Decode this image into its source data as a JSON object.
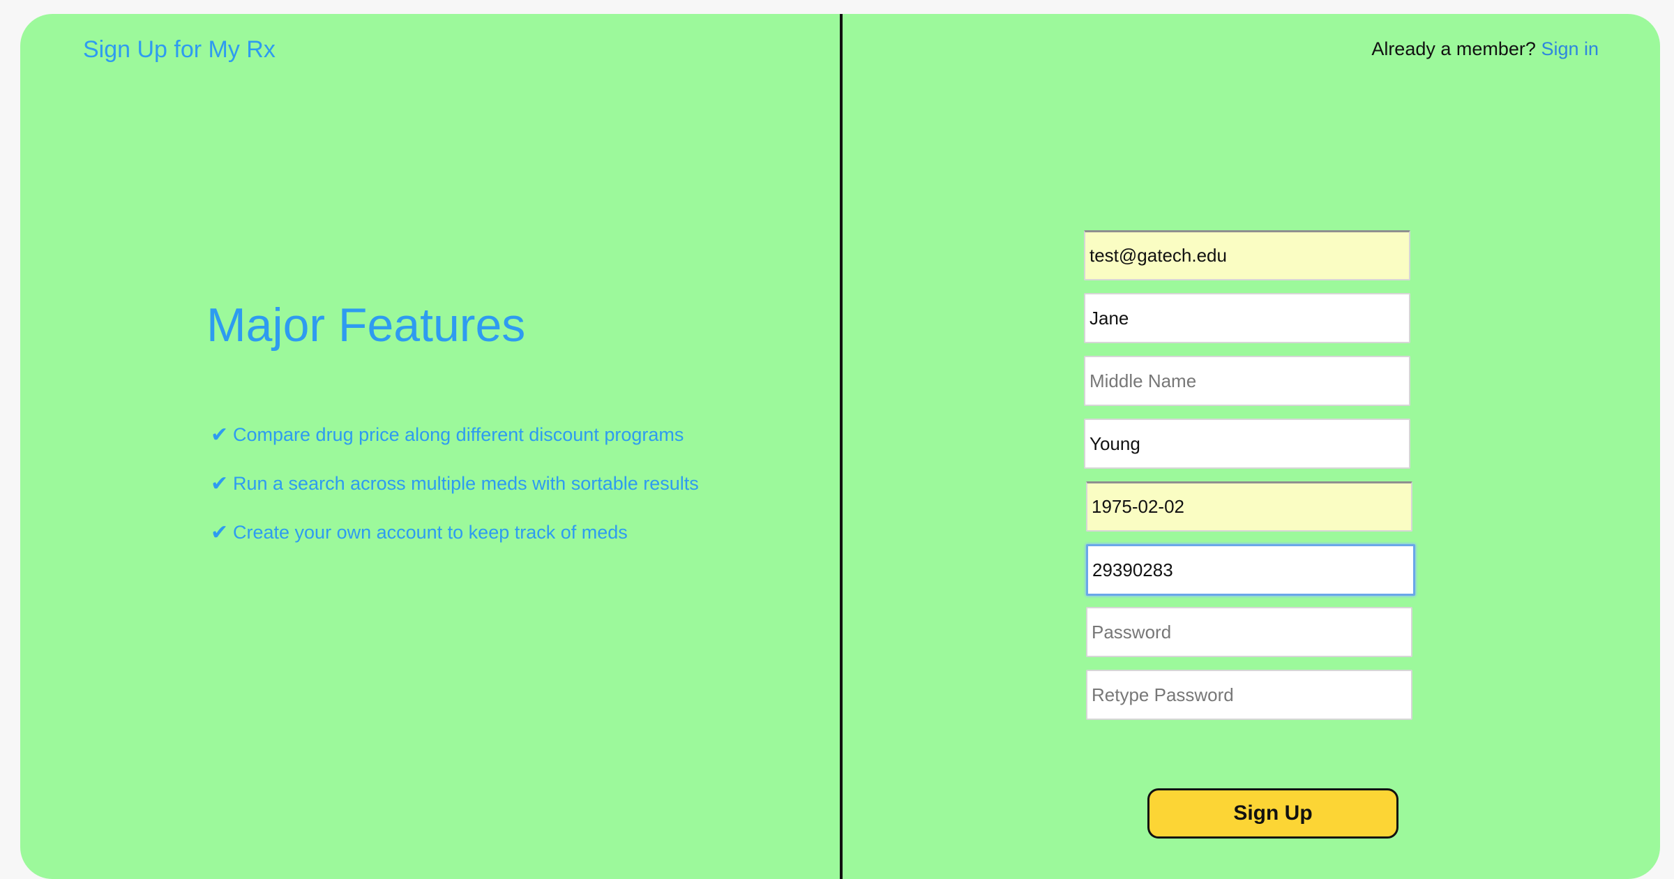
{
  "brand": {
    "title": "Sign Up for My Rx"
  },
  "features": {
    "heading": "Major Features",
    "check_icon": "✔",
    "items": [
      "Compare drug price along different discount programs",
      "Run a search across multiple meds with sortable results",
      "Create your own account to keep track of meds"
    ]
  },
  "header": {
    "member_prompt": "Already a member?",
    "signin_label": "Sign in"
  },
  "form": {
    "email": {
      "value": "test@gatech.edu",
      "placeholder": ""
    },
    "first_name": {
      "value": "Jane",
      "placeholder": ""
    },
    "middle_name": {
      "value": "",
      "placeholder": "Middle Name"
    },
    "last_name": {
      "value": "Young",
      "placeholder": ""
    },
    "dob": {
      "value": "1975-02-02",
      "placeholder": ""
    },
    "phone": {
      "value": "29390283",
      "placeholder": ""
    },
    "password": {
      "value": "",
      "placeholder": "Password"
    },
    "retype_password": {
      "value": "",
      "placeholder": "Retype Password"
    },
    "submit_label": "Sign Up"
  },
  "colors": {
    "background": "#9cf99b",
    "accent_text": "#2e9bf0",
    "link": "#2e86de",
    "button": "#fcd535",
    "autofill": "#fafdc3",
    "focus_ring": "#6aa7e8"
  }
}
